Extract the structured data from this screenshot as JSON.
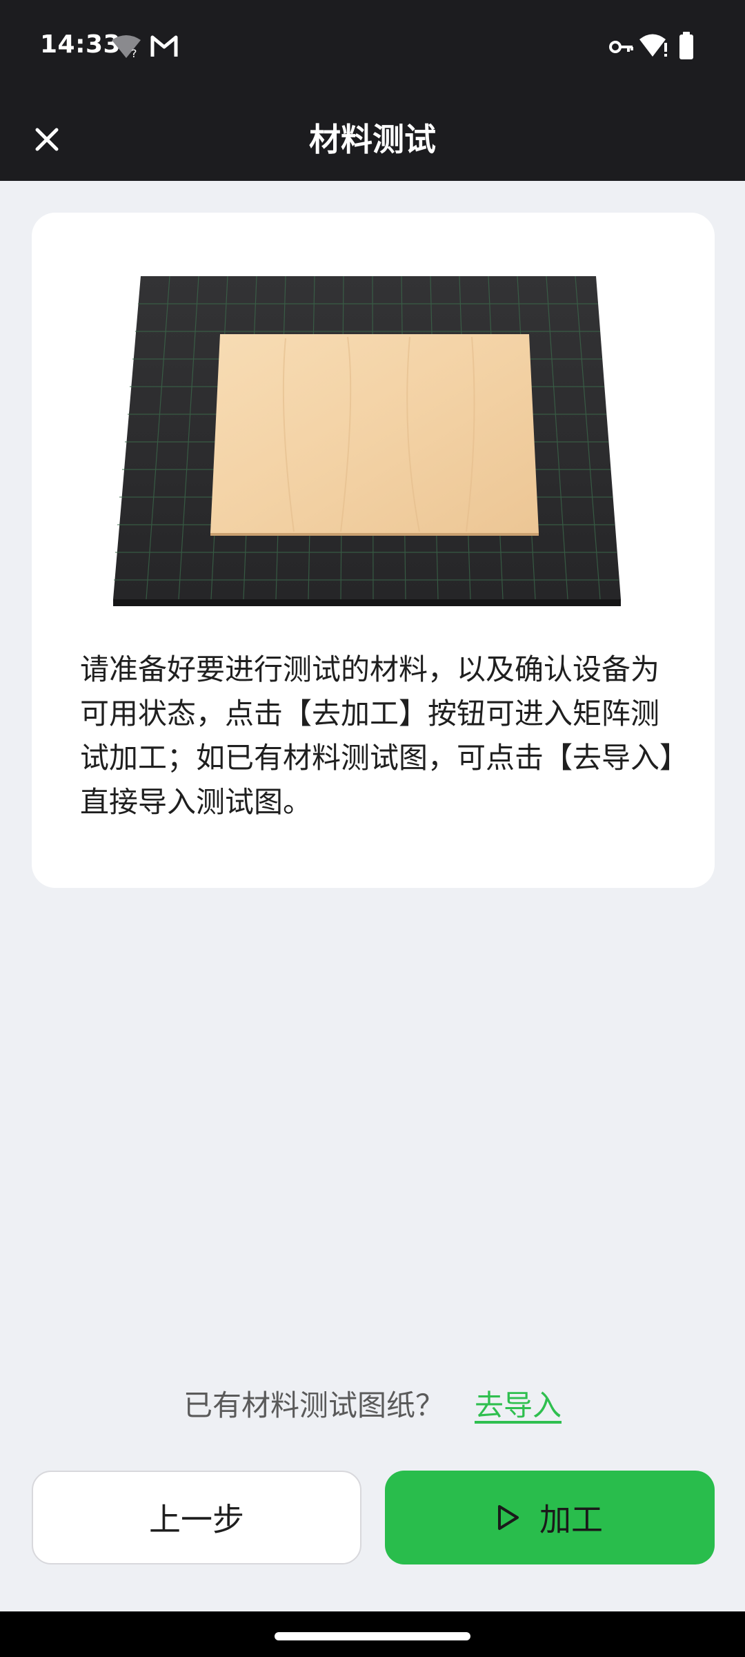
{
  "status_bar": {
    "time": "14:33"
  },
  "app_bar": {
    "title": "材料测试"
  },
  "card": {
    "description": "请准备好要进行测试的材料，以及确认设备为可用状态，点击【去加工】按钮可进入矩阵测试加工；如已有材料测试图，可点击【去导入】直接导入测试图。"
  },
  "import": {
    "question": "已有材料测试图纸？",
    "link": "去导入"
  },
  "buttons": {
    "prev": "上一步",
    "process": "加工"
  },
  "colors": {
    "accent": "#29bd4c",
    "link": "#2fbf4f",
    "bar": "#1c1c1f",
    "background": "#eef0f4"
  }
}
